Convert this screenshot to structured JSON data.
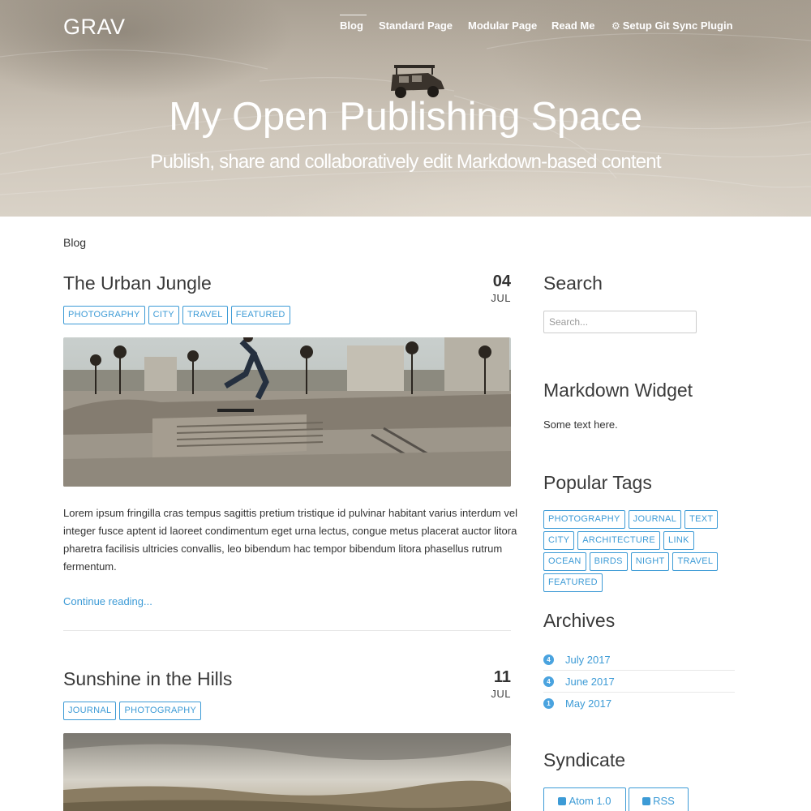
{
  "header": {
    "brand": "GRAV",
    "nav": [
      {
        "label": "Blog",
        "active": true
      },
      {
        "label": "Standard Page"
      },
      {
        "label": "Modular Page"
      },
      {
        "label": "Read Me"
      },
      {
        "label": "Setup Git Sync Plugin",
        "icon": "gear-icon"
      }
    ],
    "title": "My Open Publishing Space",
    "subtitle": "Publish, share and collaboratively edit Markdown-based content"
  },
  "breadcrumb": "Blog",
  "posts": [
    {
      "title": "The Urban Jungle",
      "day": "04",
      "month": "JUL",
      "tags": [
        "PHOTOGRAPHY",
        "CITY",
        "TRAVEL",
        "FEATURED"
      ],
      "image": "skatepark photo",
      "summary": "Lorem ipsum fringilla cras tempus sagittis pretium tristique id pulvinar habitant varius interdum vel integer fusce aptent id laoreet condimentum eget urna lectus, congue metus placerat auctor litora pharetra facilisis ultricies convallis, leo bibendum hac tempor bibendum litora phasellus rutrum fermentum.",
      "continue": "Continue reading..."
    },
    {
      "title": "Sunshine in the Hills",
      "day": "11",
      "month": "JUL",
      "tags": [
        "JOURNAL",
        "PHOTOGRAPHY"
      ],
      "image": "hills landscape photo"
    }
  ],
  "sidebar": {
    "search": {
      "heading": "Search",
      "placeholder": "Search..."
    },
    "markdown": {
      "heading": "Markdown Widget",
      "text": "Some text here."
    },
    "tags": {
      "heading": "Popular Tags",
      "items": [
        "PHOTOGRAPHY",
        "JOURNAL",
        "TEXT",
        "CITY",
        "ARCHITECTURE",
        "LINK",
        "OCEAN",
        "BIRDS",
        "NIGHT",
        "TRAVEL",
        "FEATURED"
      ]
    },
    "archives": {
      "heading": "Archives",
      "items": [
        {
          "count": "4",
          "label": "July 2017"
        },
        {
          "count": "4",
          "label": "June 2017"
        },
        {
          "count": "1",
          "label": "May 2017"
        }
      ]
    },
    "syndicate": {
      "heading": "Syndicate",
      "atom": "Atom 1.0",
      "rss": "RSS"
    }
  },
  "colors": {
    "accent": "#3d9bd6",
    "badge": "#4aa3df"
  }
}
